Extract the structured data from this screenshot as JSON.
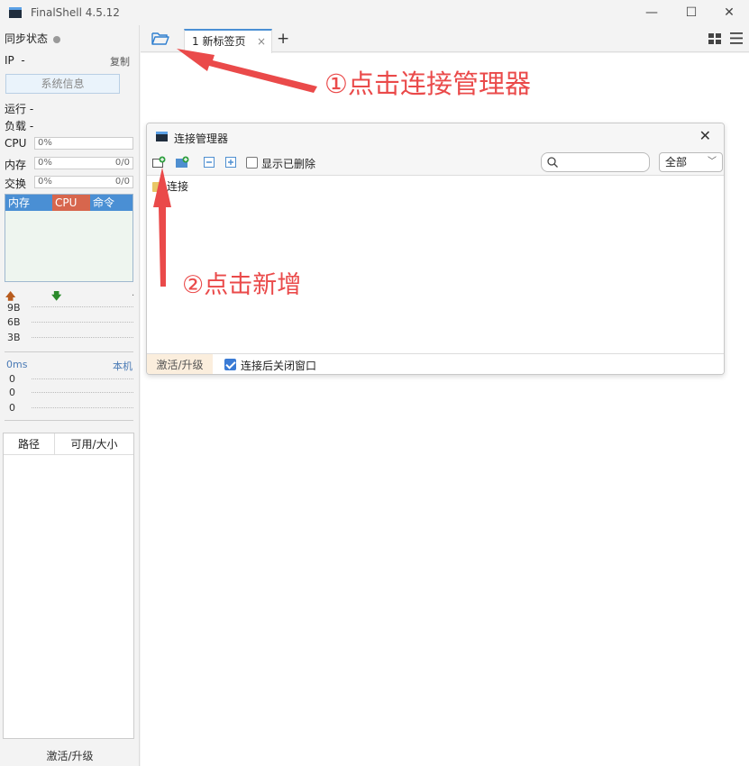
{
  "window": {
    "title": "FinalShell 4.5.12",
    "minimize_glyph": "—",
    "maximize_glyph": "☐",
    "close_glyph": "✕"
  },
  "sidebar": {
    "sync_status": "同步状态",
    "ip_label": "IP",
    "ip_value": "-",
    "copy": "复制",
    "sysinfo_button": "系统信息",
    "running": "运行 -",
    "load": "负载 -",
    "cpu_label": "CPU",
    "cpu_value": "0%",
    "mem_label": "内存",
    "mem_value": "0%",
    "mem_ratio": "0/0",
    "swap_label": "交换",
    "swap_value": "0%",
    "swap_ratio": "0/0",
    "proc_headers": [
      "内存",
      "CPU",
      "命令"
    ],
    "net_ticks": [
      "9B",
      "6B",
      "3B"
    ],
    "net_dot": ".",
    "ping_label": "0ms",
    "ping_host": "本机",
    "ping_values": [
      "0",
      "0",
      "0"
    ],
    "disk_headers": [
      "路径",
      "可用/大小"
    ],
    "activate": "激活/升级"
  },
  "tabs": {
    "active_tab": "1 新标签页",
    "close_glyph": "×",
    "add_glyph": "+"
  },
  "dialog": {
    "title": "连接管理器",
    "close_glyph": "✕",
    "show_deleted": "显示已删除",
    "search_placeholder": "",
    "filter_value": "全部",
    "tree_root": "连接",
    "activate": "激活/升级",
    "close_after_connect": "连接后关闭窗口",
    "close_after_connect_checked": true
  },
  "annotations": {
    "step1": "①点击连接管理器",
    "step2": "②点击新增",
    "color": "#ea4a4a"
  },
  "icons": {
    "folder": "folder-open-icon",
    "new_connection": "new-connection-icon",
    "new_folder": "new-folder-icon",
    "collapse": "collapse-all-icon",
    "expand": "expand-all-icon",
    "search": "search-icon",
    "layout": "layout-grid-icon",
    "menu": "hamburger-menu-icon"
  }
}
